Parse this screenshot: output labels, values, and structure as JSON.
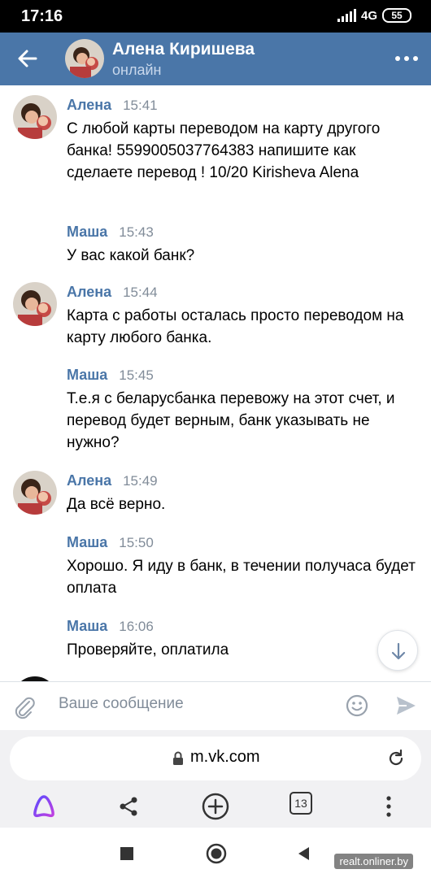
{
  "status_bar": {
    "time": "17:16",
    "network": "4G",
    "battery": "55"
  },
  "header": {
    "name": "Алена Киришева",
    "status": "онлайн",
    "accent": "#4a76a8"
  },
  "messages": [
    {
      "author": "Алена",
      "time": "15:41",
      "avatar": true,
      "text": "С любой карты переводом на карту другого банка! 5599005037764383 напишите как сделаете перевод ! 10/20 Kirisheva Alena"
    },
    {
      "author": "Маша",
      "time": "15:43",
      "avatar": false,
      "text": "У вас какой банк?"
    },
    {
      "author": "Алена",
      "time": "15:44",
      "avatar": true,
      "text": "Карта с работы осталась просто переводом на карту любого банка."
    },
    {
      "author": "Маша",
      "time": "15:45",
      "avatar": false,
      "text": "Т.е.я с беларусбанка перевожу на этот счет, и перевод будет верным, банк указывать не нужно?"
    },
    {
      "author": "Алена",
      "time": "15:49",
      "avatar": true,
      "text": "Да всё верно."
    },
    {
      "author": "Маша",
      "time": "15:50",
      "avatar": false,
      "text": "Хорошо. Я иду в банк, в течении получаса будет оплата"
    },
    {
      "author": "Маша",
      "time": "16:06",
      "avatar": false,
      "text": "Проверяйте, оплатила"
    }
  ],
  "composer": {
    "placeholder": "Ваше сообщение"
  },
  "browser": {
    "url": "m.vk.com",
    "tabs_count": "13"
  },
  "watermark": "realt.onliner.by",
  "icons": [
    "back-arrow-icon",
    "more-icon",
    "attach-icon",
    "emoji-icon",
    "send-icon",
    "lock-icon",
    "reload-icon",
    "alice-icon",
    "share-icon",
    "add-tab-icon",
    "menu-icon",
    "chevron-down-icon"
  ]
}
